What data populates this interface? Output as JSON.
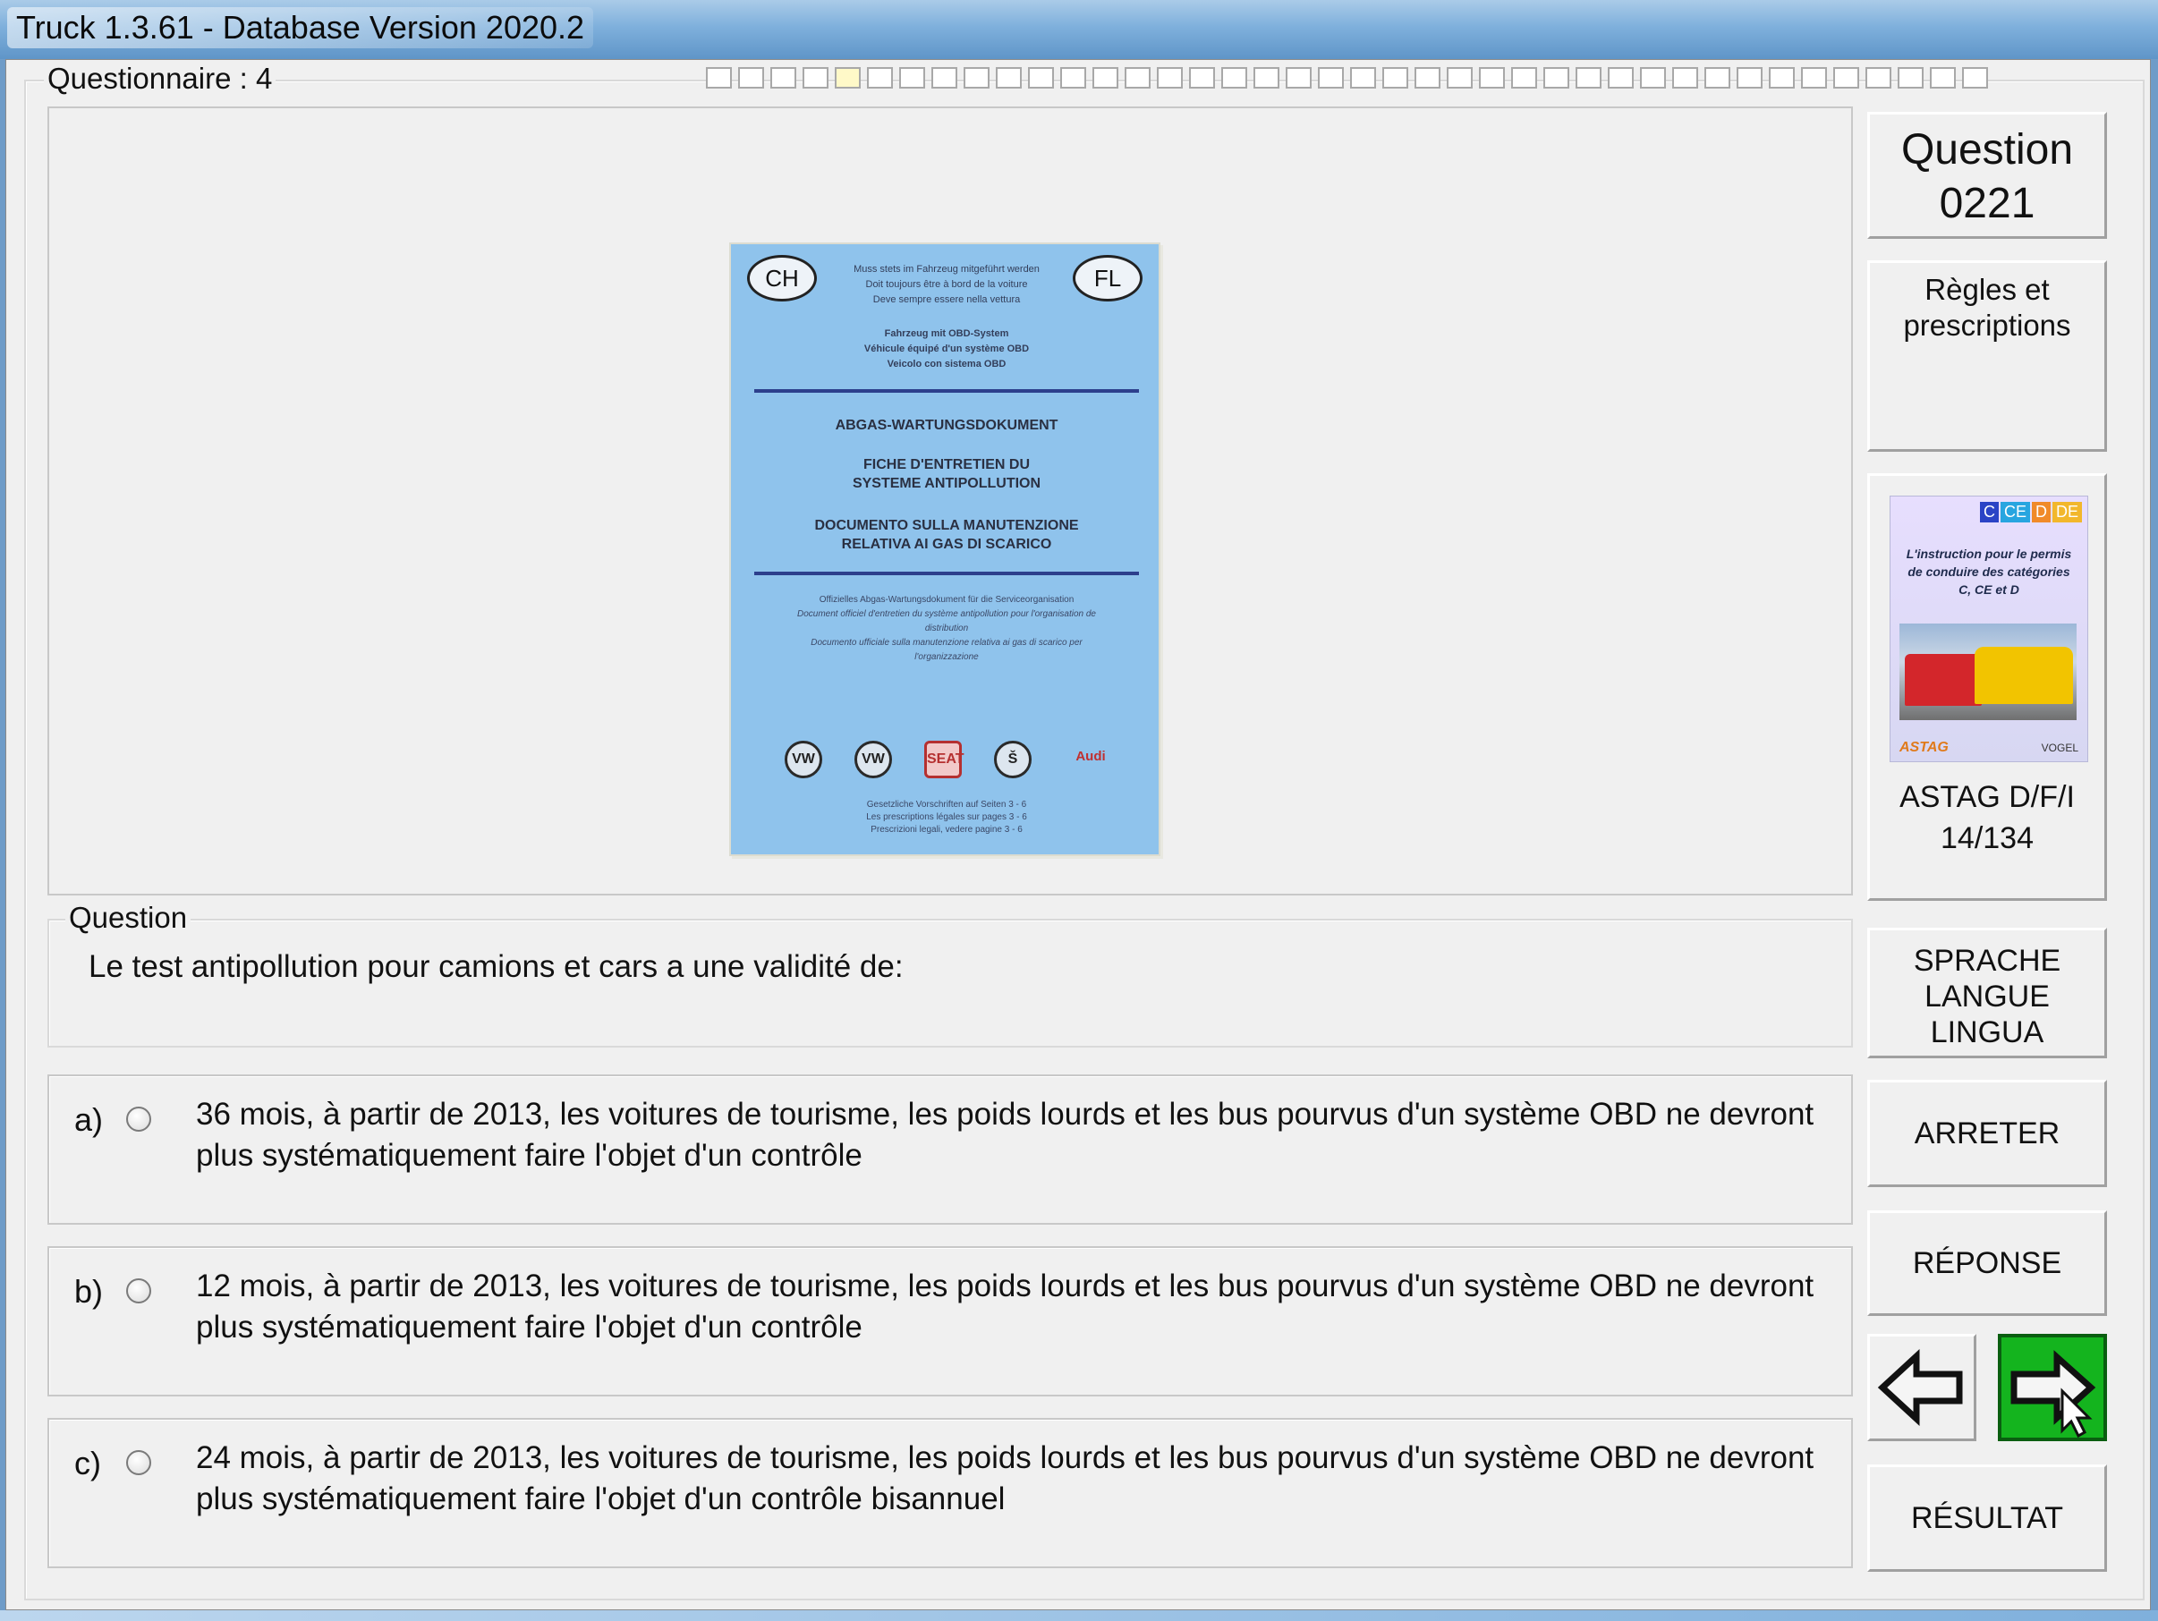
{
  "window": {
    "title": "Truck 1.3.61 - Database Version 2020.2"
  },
  "questionnaire": {
    "label": "Questionnaire : 4"
  },
  "booklet": {
    "badge_left": "CH",
    "badge_right": "FL",
    "top_notes": [
      "Muss stets im Fahrzeug mitgeführt werden",
      "Doit toujours être à bord de la voiture",
      "Deve sempre essere nella vettura"
    ],
    "obd_notes": [
      "Fahrzeug mit OBD-System",
      "Véhicule équipé d'un système OBD",
      "Veicolo con sistema OBD"
    ],
    "headings": [
      "ABGAS-WARTUNGSDOKUMENT",
      "FICHE D'ENTRETIEN DU\nSYSTEME ANTIPOLLUTION",
      "DOCUMENTO SULLA MANUTENZIONE\nRELATIVA AI GAS DI SCARICO"
    ],
    "fine_print": [
      "Offizielles Abgas-Wartungsdokument für die Serviceorganisation",
      "Document officiel d'entretien du système antipollution pour l'organisation de distribution",
      "Documento ufficiale sulla manutenzione relativa ai gas di scarico per l'organizzazione"
    ],
    "logos": [
      "VW",
      "VW",
      "SEAT",
      "Š",
      "Audi"
    ],
    "footer": [
      "Gesetzliche Vorschriften auf Seiten 3 - 6",
      "Les prescriptions légales sur pages 3 - 6",
      "Prescrizioni legali, vedere pagine 3 - 6"
    ]
  },
  "sidebar": {
    "question_label": "Question",
    "question_number": "0221",
    "category": "Règles et prescriptions",
    "book": {
      "badges": [
        "C",
        "CE",
        "D",
        "DE"
      ],
      "cover_text": "L'instruction pour le permis de conduire des catégories C, CE et D",
      "brand_left": "ASTAG",
      "brand_right": "VOGEL",
      "source": "ASTAG D/F/I",
      "page": "14/134"
    },
    "language_button": [
      "SPRACHE",
      "LANGUE",
      "LINGUA"
    ],
    "stop_button": "ARRETER",
    "answer_button": "RÉPONSE",
    "result_button": "RÉSULTAT"
  },
  "question": {
    "group_label": "Question",
    "text": "Le test antipollution pour camions et cars a une validité de:"
  },
  "answers": [
    {
      "letter": "a)",
      "text": "36 mois, à partir de 2013, les voitures de tourisme, les poids lourds et les bus pourvus d'un système OBD ne devront plus systématiquement faire l'objet d'un contrôle"
    },
    {
      "letter": "b)",
      "text": "12 mois,  à partir de 2013, les voitures de tourisme, les poids lourds et les bus pourvus d'un système OBD ne devront plus systématiquement faire l'objet d'un contrôle"
    },
    {
      "letter": "c)",
      "text": "24 mois, à partir de 2013, les voitures de tourisme, les poids lourds et les bus pourvus d'un système OBD ne devront plus systématiquement faire l'objet d'un contrôle bisannuel"
    }
  ],
  "colors": {
    "next_button": "#14b41e",
    "booklet_blue": "#8fc3ec",
    "titlebar": "#7fb0dc"
  },
  "icons": {
    "back": "arrow-left-icon",
    "next": "arrow-right-icon",
    "cursor": "mouse-pointer-icon"
  }
}
